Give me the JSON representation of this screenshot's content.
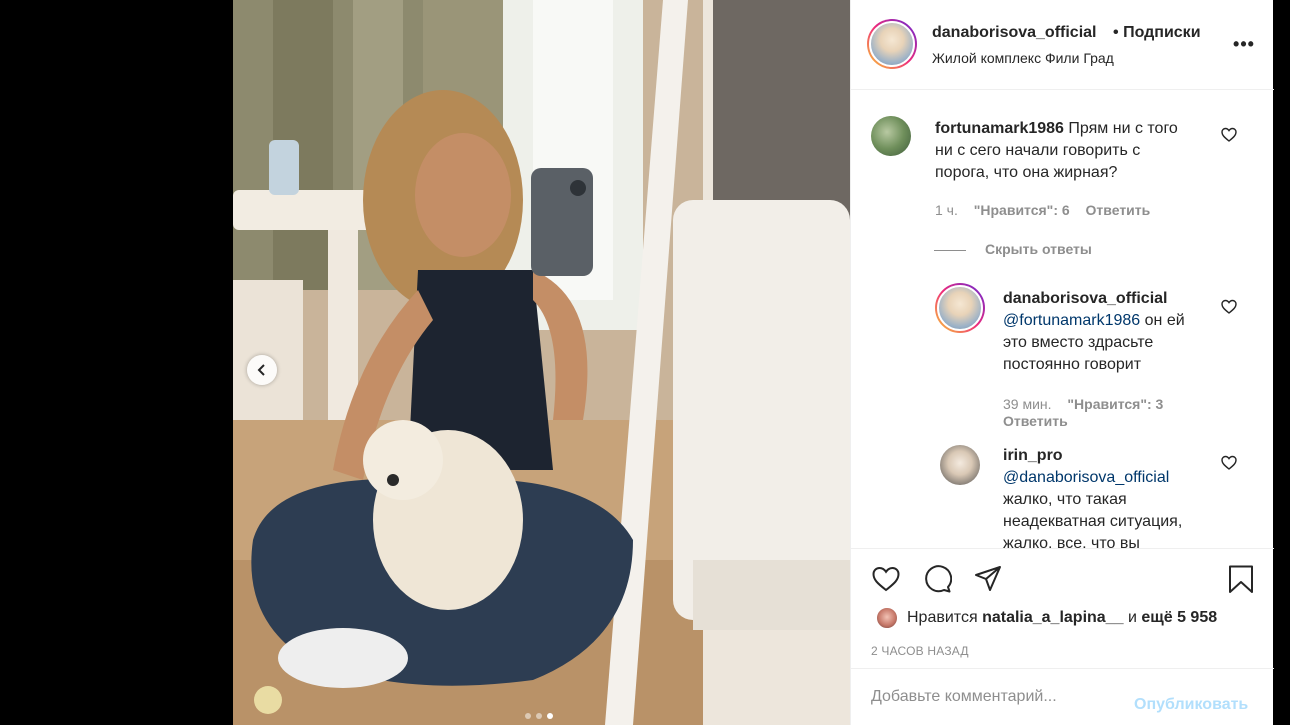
{
  "post": {
    "username": "danaborisova_official",
    "separator": "•",
    "follow_label": "Подписки",
    "location": "Жилой комплекс Фили Град",
    "more_label": "•••"
  },
  "comments": [
    {
      "username": "fortunamark1986",
      "text": "Прям ни с того ни с сего начали говорить с порога, что она жирная?",
      "time": "1 ч.",
      "likes": "\"Нравится\": 6",
      "reply_label": "Ответить"
    }
  ],
  "hide_replies_label": "Скрыть ответы",
  "replies": [
    {
      "username": "danaborisova_official",
      "mention": "@fortunamark1986",
      "text": "он ей это вместо здрасьте постоянно говорит",
      "time": "39 мин.",
      "likes": "\"Нравится\": 3",
      "reply_label": "Ответить"
    },
    {
      "username": "irin_pro",
      "mention": "@danaborisova_official",
      "text": "жалко, что такая неадекватная ситуация, ",
      "text_cut": "жалко, все, что вы"
    }
  ],
  "likes_line": {
    "prefix": "Нравится",
    "user": "natalia_a_lapina__",
    "middle": "и",
    "others": "ещё 5 958"
  },
  "timestamp": "2 ЧАСОВ НАЗАД",
  "comment_input": {
    "placeholder": "Добавьте комментарий...",
    "publish_label": "Опубликовать"
  },
  "carousel": {
    "total": 3,
    "active": 3
  },
  "icons": [
    "chevron-left-icon",
    "heart-icon",
    "comment-icon",
    "share-icon",
    "bookmark-icon",
    "more-icon"
  ]
}
